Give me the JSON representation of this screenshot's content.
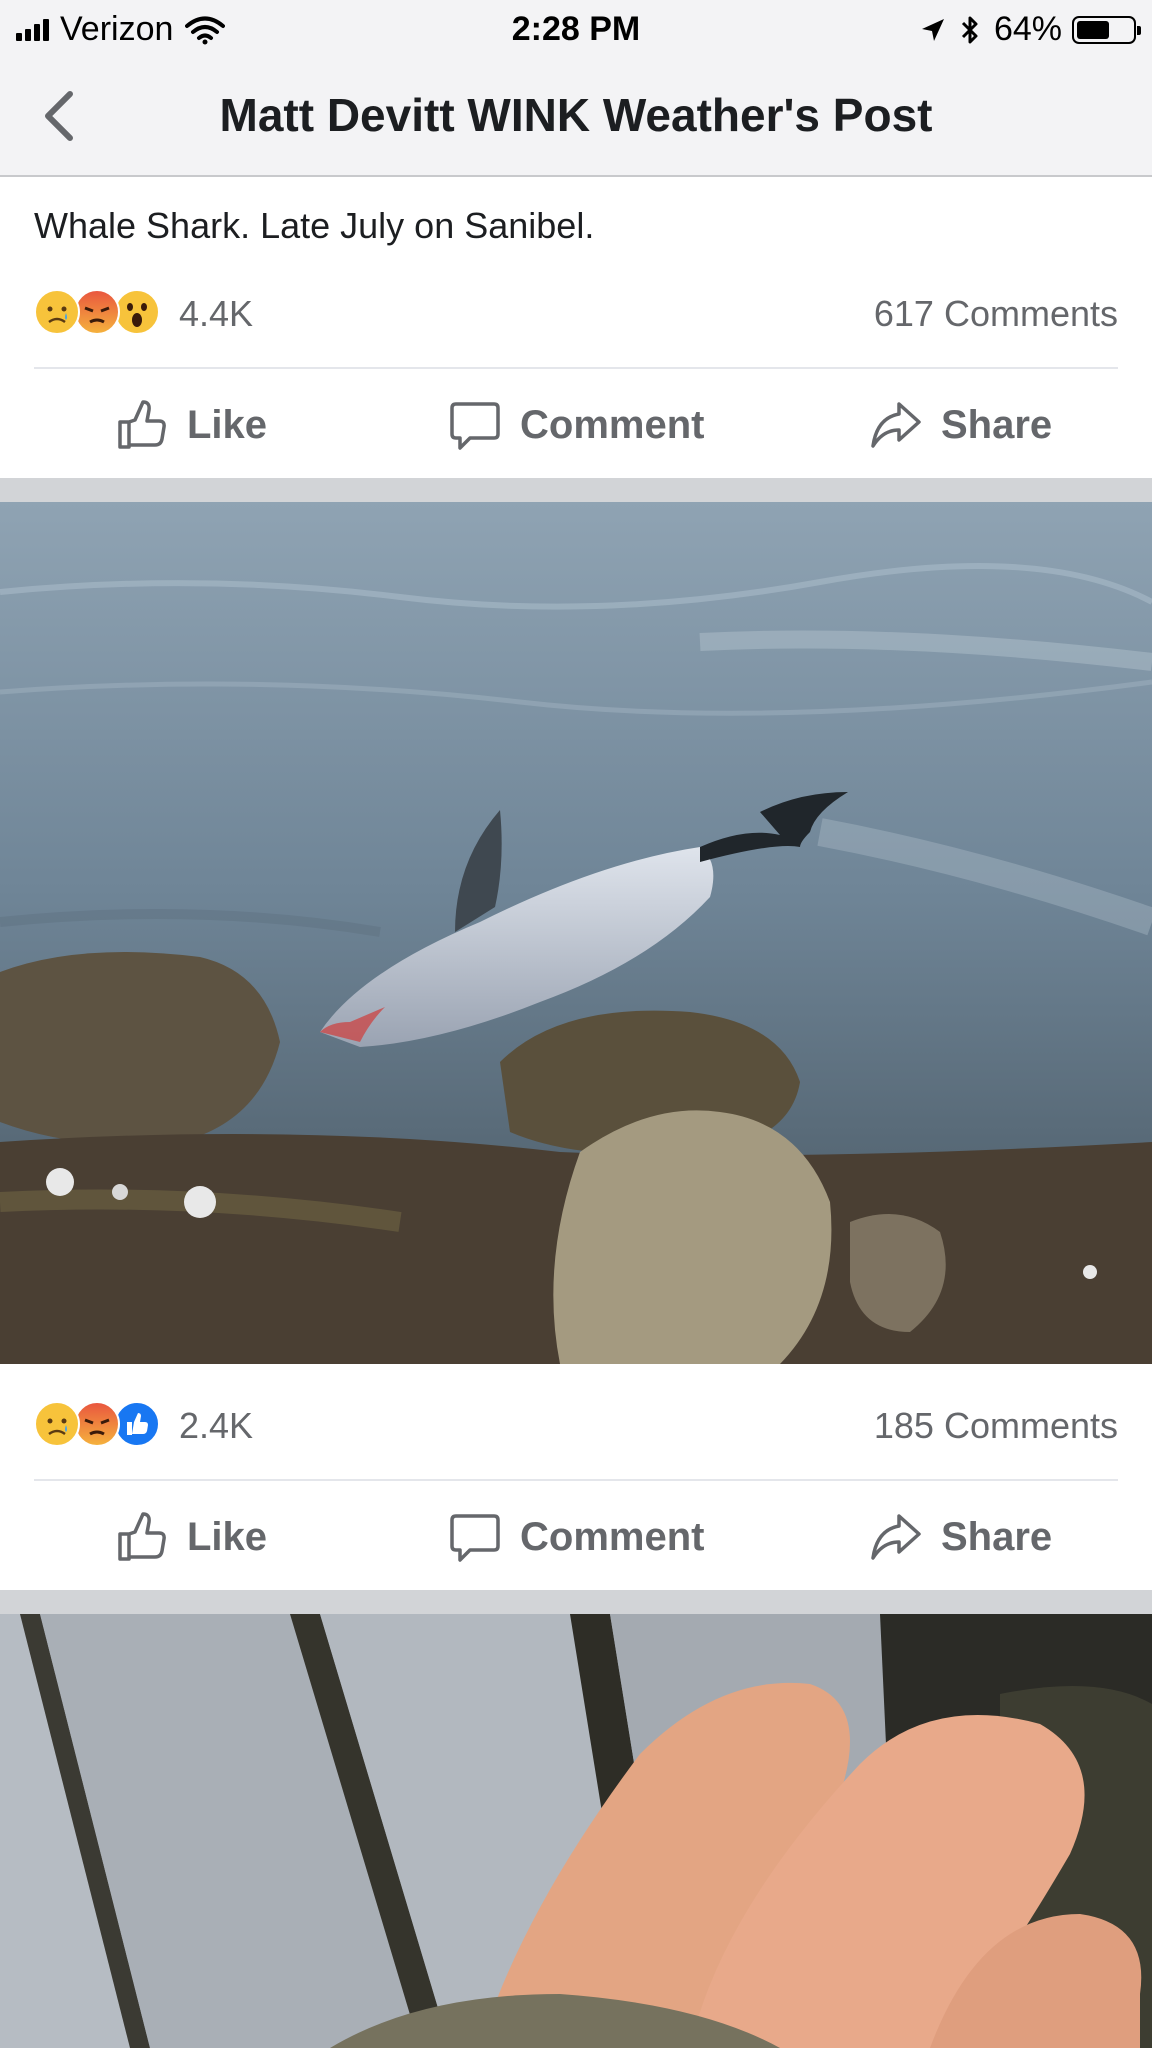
{
  "status_bar": {
    "carrier": "Verizon",
    "time": "2:28 PM",
    "battery_percent": "64%",
    "battery_level": 0.64
  },
  "nav": {
    "title": "Matt Devitt WINK Weather's Post",
    "back_icon": "chevron-left-icon"
  },
  "post": {
    "text": "Whale Shark. Late July on Sanibel.",
    "reactions": {
      "icons": [
        "sad",
        "angry",
        "wow"
      ],
      "count": "4.4K"
    },
    "comments": "617 Comments",
    "actions": {
      "like": "Like",
      "comment": "Comment",
      "share": "Share"
    }
  },
  "photo1": {
    "subject": "stranded-animal-in-water",
    "reactions": {
      "icons": [
        "sad",
        "angry",
        "like"
      ],
      "count": "2.4K"
    },
    "comments": "185 Comments",
    "actions": {
      "like": "Like",
      "comment": "Comment",
      "share": "Share"
    }
  },
  "photo2": {
    "subject": "fingers-holding-object"
  },
  "colors": {
    "text_primary": "#1c1e21",
    "text_secondary": "#65676b",
    "nav_bg": "#f3f3f5",
    "separator": "#d2d4d7",
    "like_blue": "#1877f2",
    "sad_yellow": "#f7c33b",
    "angry_red": "#e9573f"
  }
}
